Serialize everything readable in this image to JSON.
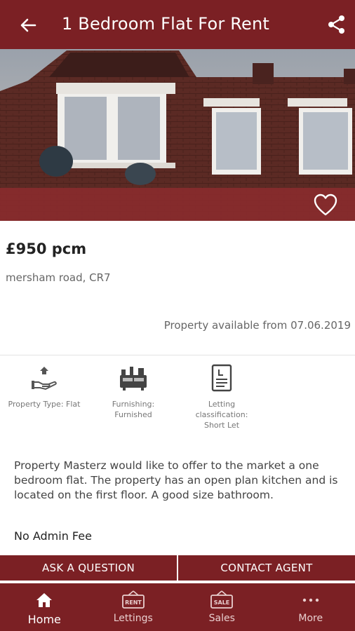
{
  "header": {
    "title": "1 Bedroom Flat For Rent",
    "back_icon": "arrow-left-icon",
    "share_icon": "share-icon"
  },
  "listing": {
    "price": "£950 pcm",
    "address": "mersham road, CR7",
    "availability": "Property available from 07.06.2019",
    "description": "Property Masterz would like to offer to the market a one bedroom flat. The property has an open plan kitchen and is located on the first floor. A good size bathroom.",
    "note": "No Admin Fee"
  },
  "features": [
    {
      "icon": "hand-house-icon",
      "label": "Property Type: Flat"
    },
    {
      "icon": "furniture-icon",
      "label": "Furnishing: Furnished"
    },
    {
      "icon": "document-icon",
      "label": "Letting classification: Short Let"
    }
  ],
  "actions": {
    "ask": "ASK A QUESTION",
    "contact": "CONTACT AGENT"
  },
  "nav": [
    {
      "label": "Home",
      "icon": "home-icon",
      "active": true
    },
    {
      "label": "Lettings",
      "icon": "rent-sign-icon"
    },
    {
      "label": "Sales",
      "icon": "sale-sign-icon"
    },
    {
      "label": "More",
      "icon": "more-dots-icon"
    }
  ],
  "colors": {
    "brand": "#7b2024",
    "text": "#222222",
    "muted": "#666666"
  }
}
